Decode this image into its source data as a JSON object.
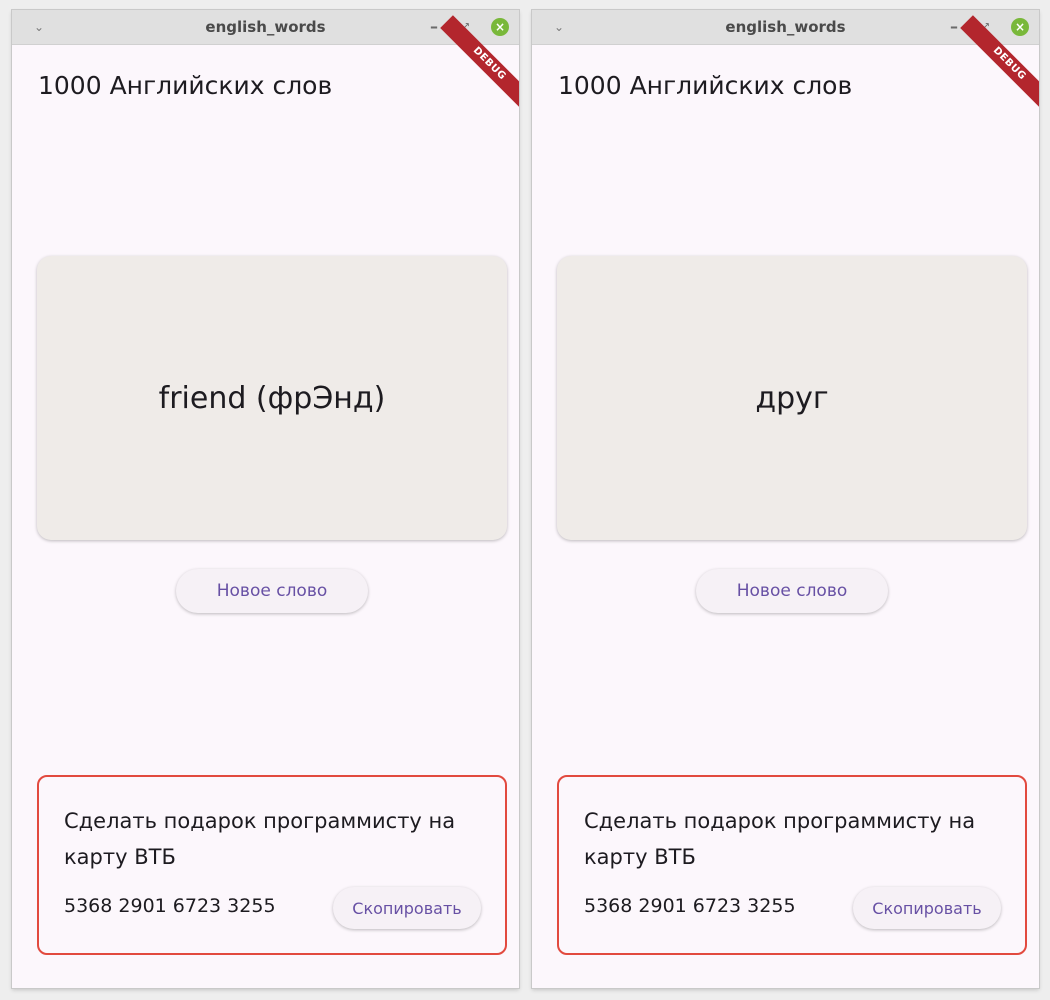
{
  "windows": [
    {
      "title": "english_words",
      "debug_label": "DEBUG",
      "app_title": "1000 Английских слов",
      "word": "friend (фрЭнд)",
      "new_word_label": "Новое слово",
      "gift_text": "Сделать подарок программисту на карту ВТБ",
      "card_number": "5368 2901 6723 3255",
      "copy_label": "Скопировать"
    },
    {
      "title": "english_words",
      "debug_label": "DEBUG",
      "app_title": "1000 Английских слов",
      "word": "друг",
      "new_word_label": "Новое слово",
      "gift_text": "Сделать подарок программисту на карту ВТБ",
      "card_number": "5368 2901 6723 3255",
      "copy_label": "Скопировать"
    }
  ],
  "colors": {
    "accent": "#6750a4",
    "gift_border": "#e24a3f",
    "card_background": "#efebe8",
    "debug_banner": "#b3262d"
  },
  "icons": {
    "window_menu": "chevron-down-icon",
    "minimize": "minimize-icon",
    "maximize": "maximize-icon",
    "close": "close-icon"
  }
}
